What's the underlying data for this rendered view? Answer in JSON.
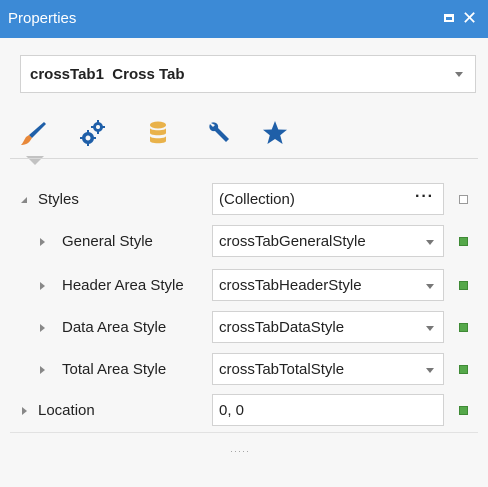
{
  "window": {
    "title": "Properties",
    "close_glyph": "✕"
  },
  "selector": {
    "name": "crossTab1",
    "type": "Cross Tab"
  },
  "tabs": [
    {
      "icon": "paintbrush-icon",
      "active": true
    },
    {
      "icon": "gears-icon",
      "active": false
    },
    {
      "icon": "database-icon",
      "active": false
    },
    {
      "icon": "wrench-icon",
      "active": false
    },
    {
      "icon": "star-icon",
      "active": false
    }
  ],
  "properties": {
    "styles": {
      "label": "Styles",
      "value": "(Collection)",
      "ellipsis": "···"
    },
    "general_style": {
      "label": "General Style",
      "value": "crossTabGeneralStyle"
    },
    "header_area_style": {
      "label": "Header Area Style",
      "value": "crossTabHeaderStyle"
    },
    "data_area_style": {
      "label": "Data Area Style",
      "value": "crossTabDataStyle"
    },
    "total_area_style": {
      "label": "Total Area Style",
      "value": "crossTabTotalStyle"
    },
    "location": {
      "label": "Location",
      "value": "0, 0"
    }
  },
  "colors": {
    "titlebar": "#3c8ad6",
    "accent_blue": "#1f5fa8",
    "brush_orange": "#e8883a",
    "db_yellow": "#e9b24a",
    "marker_green": "#55a84a"
  },
  "grip": "·····"
}
